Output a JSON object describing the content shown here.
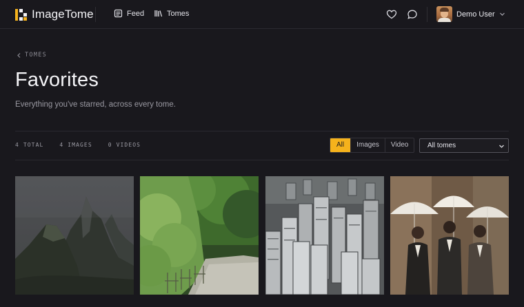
{
  "app": {
    "name": "ImageTome"
  },
  "nav": {
    "feed_label": "Feed",
    "tomes_label": "Tomes"
  },
  "header_icons": [
    "heart-icon",
    "chat-bubble-icon"
  ],
  "user": {
    "name": "Demo User"
  },
  "breadcrumb": {
    "label": "TOMES"
  },
  "page": {
    "title": "Favorites",
    "subtitle": "Everything you've starred, across every tome."
  },
  "stats": {
    "total": "4 TOTAL",
    "images": "4 IMAGES",
    "videos": "0 VIDEOS"
  },
  "filters": {
    "options": [
      "All",
      "Images",
      "Video"
    ],
    "selected": "All",
    "tome_select": {
      "value": "All tomes"
    }
  },
  "gallery": {
    "items": [
      {
        "kind": "image",
        "subject": "misty mountain peaks"
      },
      {
        "kind": "image",
        "subject": "park path with chairs and trees"
      },
      {
        "kind": "image",
        "subject": "aerial view of high-rise apartments"
      },
      {
        "kind": "image",
        "subject": "three men with white umbrellas"
      }
    ]
  },
  "colors": {
    "background": "#19181d",
    "accent": "#f5b21c",
    "text": "#f4f4f7",
    "muted": "#9a99a2"
  }
}
